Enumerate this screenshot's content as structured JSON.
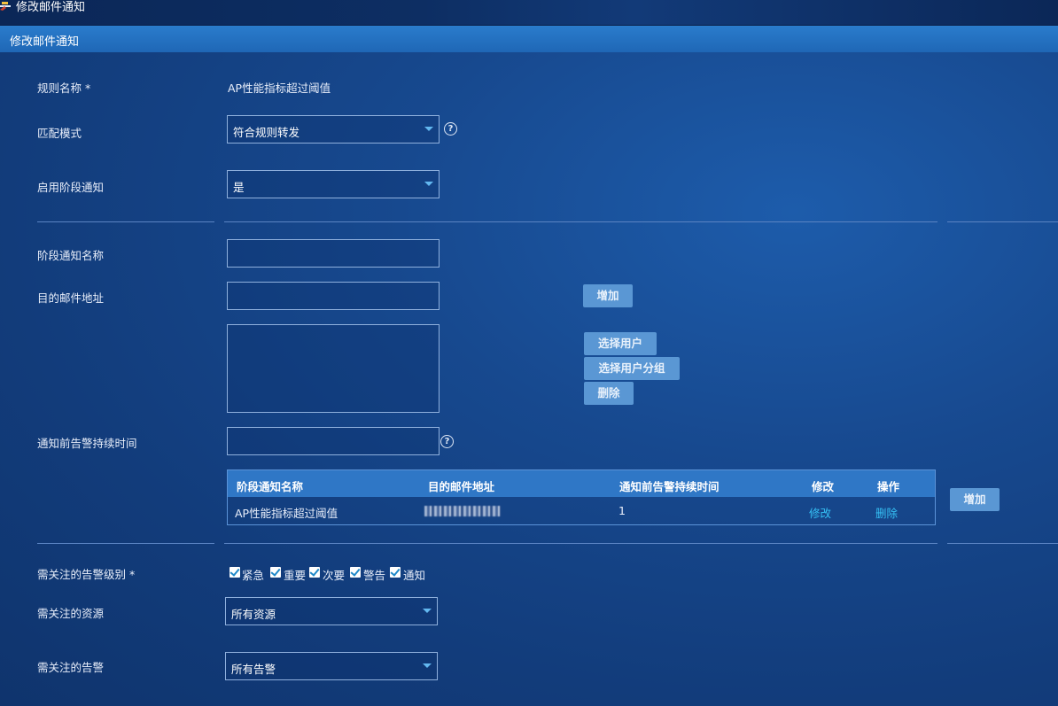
{
  "window": {
    "title": "修改邮件通知"
  },
  "section": {
    "title": "修改邮件通知"
  },
  "form": {
    "rule_name_label": "规则名称 *",
    "rule_name_value": "AP性能指标超过阈值",
    "match_mode_label": "匹配模式",
    "match_mode_value": "符合规则转发",
    "stage_enable_label": "启用阶段通知",
    "stage_enable_value": "是",
    "stage_name_label": "阶段通知名称",
    "stage_name_value": "",
    "email_label": "目的邮件地址",
    "email_value": "",
    "add_button": "增加",
    "select_user_button": "选择用户",
    "select_group_button": "选择用户分组",
    "delete_button": "删除",
    "duration_label": "通知前告警持续时间",
    "duration_value": "",
    "add_stage_button": "增加",
    "severity_label": "需关注的告警级别 *",
    "severities": [
      "紧急",
      "重要",
      "次要",
      "警告",
      "通知"
    ],
    "resource_label": "需关注的资源",
    "resource_value": "所有资源",
    "alarm_label": "需关注的告警",
    "alarm_value": "所有告警"
  },
  "table": {
    "headers": [
      "阶段通知名称",
      "目的邮件地址",
      "通知前告警持续时间",
      "修改",
      "操作"
    ],
    "rows": [
      {
        "name": "AP性能指标超过阈值",
        "email": "",
        "duration": "1",
        "edit": "修改",
        "delete": "删除"
      }
    ]
  },
  "colors": {
    "accent": "#2f77c6",
    "link": "#36c1f5",
    "button": "#5a97d4"
  }
}
